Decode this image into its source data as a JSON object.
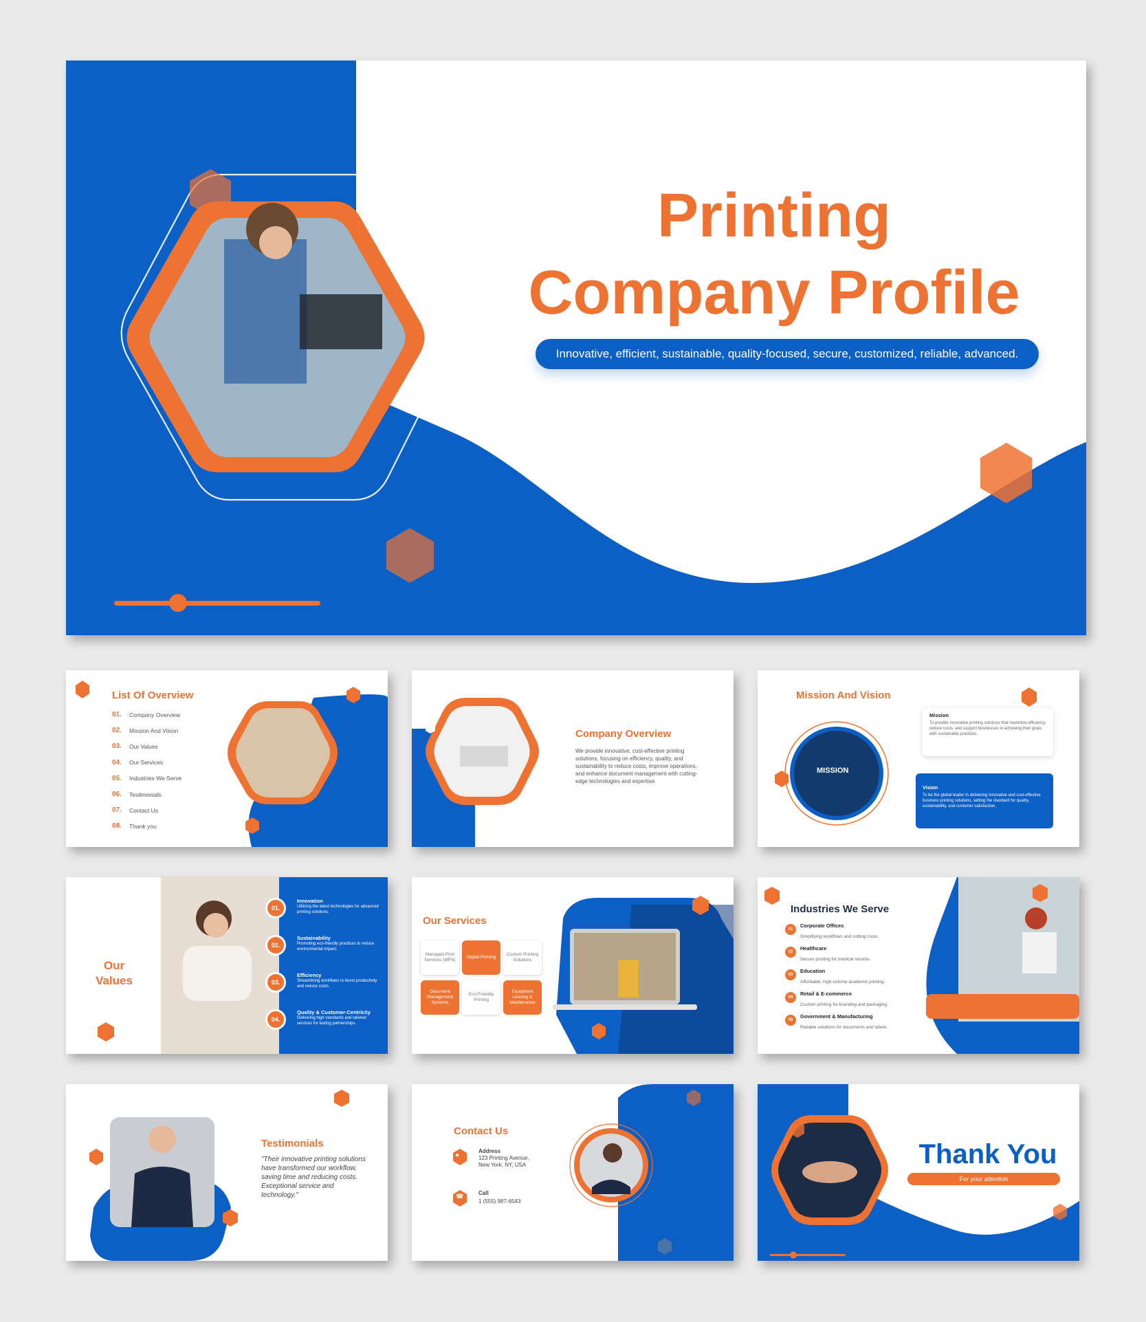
{
  "colors": {
    "blue": "#0c5fc5",
    "orange": "#ee7232",
    "dark": "#1e2e44",
    "bg": "#eaeaea"
  },
  "hero": {
    "title_line1": "Printing",
    "title_line2": "Company Profile",
    "tagline": "Innovative, efficient, sustainable, quality-focused, secure, customized, reliable, advanced.",
    "photo_icon": "woman-at-printer-photo"
  },
  "overview": {
    "title": "List Of Overview",
    "items": [
      {
        "num": "01.",
        "label": "Company Overview"
      },
      {
        "num": "02.",
        "label": "Mission And Vision"
      },
      {
        "num": "03.",
        "label": "Our Values"
      },
      {
        "num": "04.",
        "label": "Our Services"
      },
      {
        "num": "05.",
        "label": "Industries We Serve"
      },
      {
        "num": "06.",
        "label": "Testimonials"
      },
      {
        "num": "07.",
        "label": "Contact Us"
      },
      {
        "num": "08.",
        "label": "Thank you"
      }
    ]
  },
  "company": {
    "title": "Company Overview",
    "text": "We provide innovative, cost-effective printing solutions, focusing on efficiency, quality, and sustainability to reduce costs, improve operations, and enhance document management with cutting-edge technologies and expertise."
  },
  "mission": {
    "title": "Mission And Vision",
    "photo_label": "MISSION",
    "mission_title": "Mission",
    "mission_text": "To provide innovative printing solutions that maximize efficiency, reduce costs, and support businesses in achieving their goals with sustainable practices.",
    "vision_title": "Vision",
    "vision_text": "To be the global leader in delivering innovative and cost-effective business printing solutions, setting the standard for quality, sustainability, and customer satisfaction."
  },
  "values": {
    "title_line1": "Our",
    "title_line2": "Values",
    "items": [
      {
        "num": "01.",
        "title": "Innovation",
        "text": "Utilizing the latest technologies for advanced printing solutions."
      },
      {
        "num": "02.",
        "title": "Sustainability",
        "text": "Promoting eco-friendly practices to reduce environmental impact."
      },
      {
        "num": "03.",
        "title": "Efficiency",
        "text": "Streamlining workflows to boost productivity and reduce costs."
      },
      {
        "num": "04.",
        "title": "Quality & Customer-Centricity",
        "text": "Delivering high standards and tailored services for lasting partnerships."
      }
    ]
  },
  "services": {
    "title": "Our Services",
    "boxes": [
      {
        "label": "Managed Print Services (MPS)",
        "style": "white"
      },
      {
        "label": "Digital Printing",
        "style": "orange"
      },
      {
        "label": "Custom Printing Solutions",
        "style": "white"
      },
      {
        "label": "Document Management Systems",
        "style": "orange"
      },
      {
        "label": "Eco-Friendly Printing",
        "style": "white"
      },
      {
        "label": "Equipment Leasing & Maintenance",
        "style": "orange"
      }
    ]
  },
  "industries": {
    "title": "Industries We Serve",
    "items": [
      {
        "num": "01",
        "title": "Corporate Offices",
        "text": "Simplifying workflows and cutting costs."
      },
      {
        "num": "02",
        "title": "Healthcare",
        "text": "Secure printing for medical records."
      },
      {
        "num": "03",
        "title": "Education",
        "text": "Affordable, high-volume academic printing."
      },
      {
        "num": "04",
        "title": "Retail & E-commerce",
        "text": "Custom printing for branding and packaging."
      },
      {
        "num": "05",
        "title": "Government & Manufacturing",
        "text": "Reliable solutions for documents and labels."
      }
    ]
  },
  "testimonials": {
    "title": "Testimonials",
    "quote": "\"Their innovative printing solutions have transformed our workflow, saving time and reducing costs. Exceptional service and technology.\""
  },
  "contact": {
    "title": "Contact Us",
    "address_label": "Address",
    "address_line1": "123 Printing Avenue,",
    "address_line2": "New York, NY, USA",
    "call_label": "Call",
    "phone": "1 (555) 987-6543",
    "address_icon": "location-pin-icon",
    "call_icon": "phone-icon"
  },
  "thanks": {
    "title": "Thank You",
    "subtitle": "For your attention"
  }
}
